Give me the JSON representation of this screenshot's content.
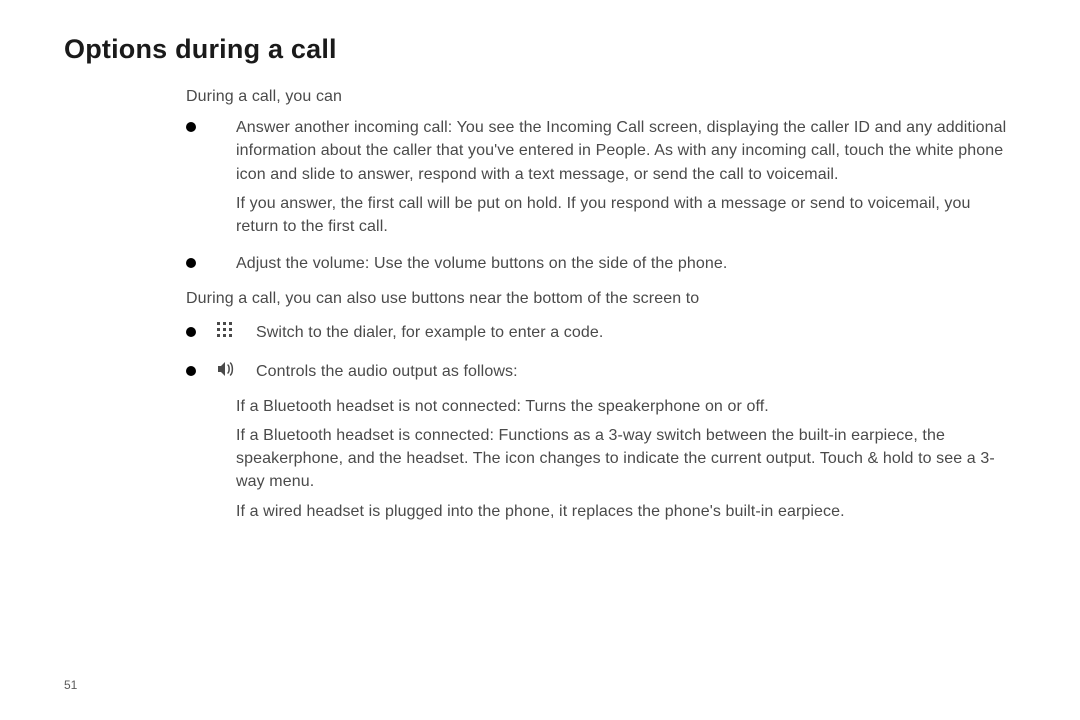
{
  "title": "Options during a call",
  "intro1": "During a call, you can",
  "bullets1": [
    {
      "paragraphs": [
        "Answer another incoming call: You see the Incoming Call screen, displaying the caller ID and any additional information about the caller that you've entered in People. As with any incoming call, touch the white phone icon and slide to answer, respond with a text message, or send the call to voicemail.",
        "If you answer, the first call will be put on hold. If you respond with a message or send to voicemail, you return to the first call."
      ]
    },
    {
      "paragraphs": [
        "Adjust the volume: Use the volume buttons on the side of the phone."
      ]
    }
  ],
  "intro2": "During a call, you can also use buttons near the bottom of the screen to",
  "iconBullets": [
    {
      "icon": "dialpad-icon",
      "lead": "Switch to the dialer, for example to enter a code.",
      "continuation": []
    },
    {
      "icon": "speaker-icon",
      "lead": "Controls the audio output as follows:",
      "continuation": [
        "If a Bluetooth headset is not connected: Turns the speakerphone on or off.",
        "If a Bluetooth headset is connected: Functions as a 3-way switch between the built-in earpiece, the speakerphone, and the headset. The icon changes to indicate the current output. Touch & hold to see a 3-way menu.",
        "If a wired headset is plugged into the phone, it replaces the phone's built-in earpiece."
      ]
    }
  ],
  "pageNumber": "51"
}
